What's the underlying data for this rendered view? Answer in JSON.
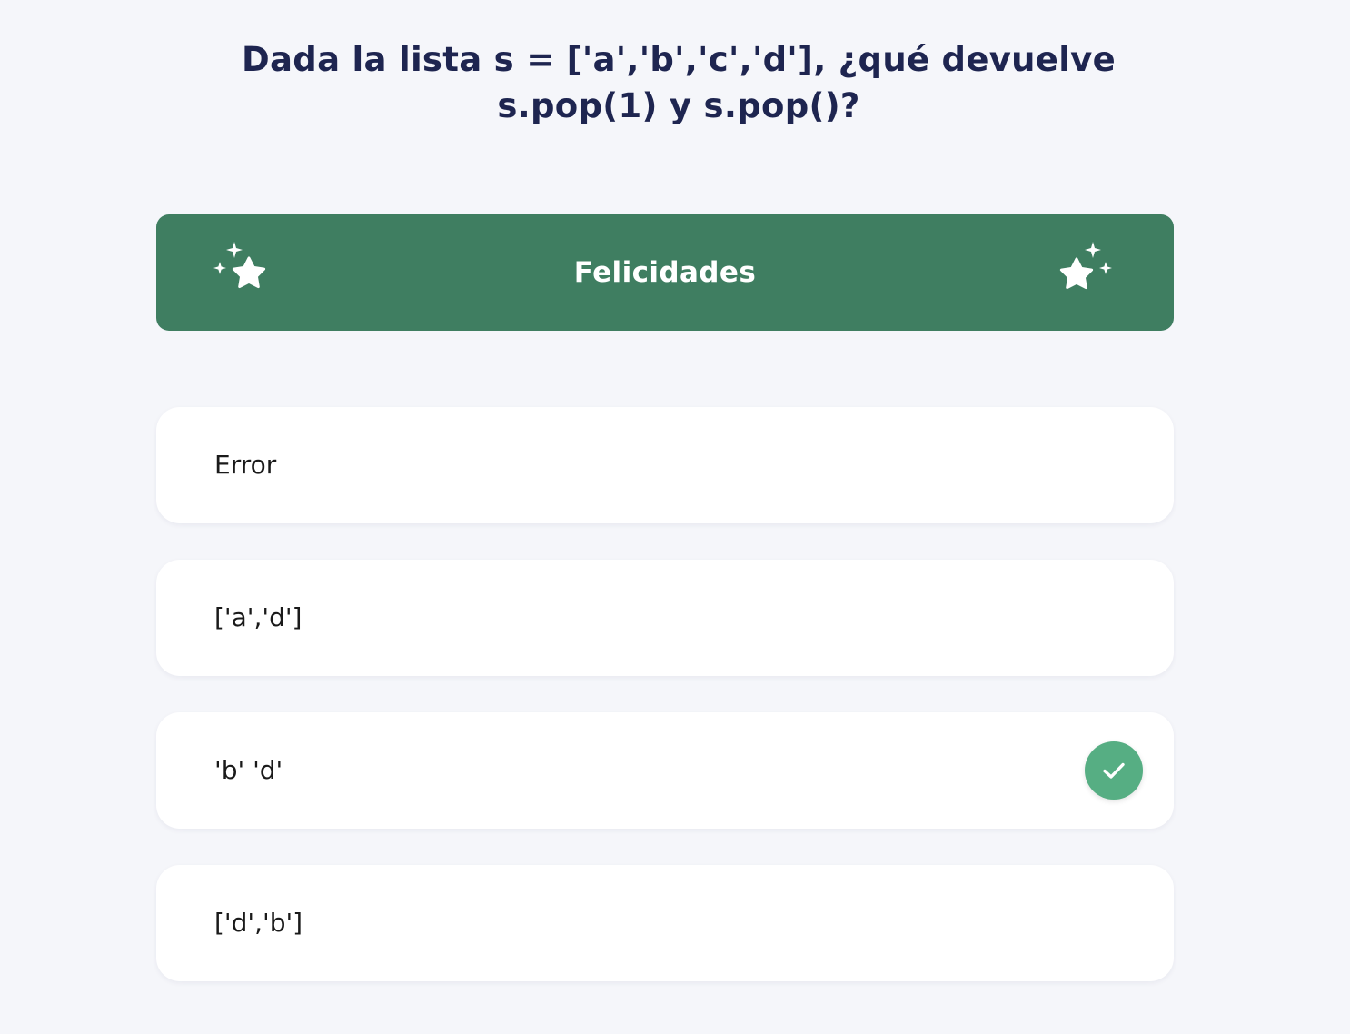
{
  "question": {
    "text": "Dada la lista s = ['a','b','c','d'], ¿qué devuelve s.pop(1) y s.pop()?"
  },
  "banner": {
    "title": "Felicidades",
    "color": "#3f7e61",
    "left_icon": "sparkle-star-icon",
    "right_icon": "sparkle-star-icon"
  },
  "options": [
    {
      "label": "Error",
      "correct": false
    },
    {
      "label": "['a','d']",
      "correct": false
    },
    {
      "label": "'b' 'd'",
      "correct": true
    },
    {
      "label": "['d','b']",
      "correct": false
    }
  ],
  "colors": {
    "background": "#f5f6fa",
    "question_text": "#1e2550",
    "correct_badge": "#56ae83"
  }
}
